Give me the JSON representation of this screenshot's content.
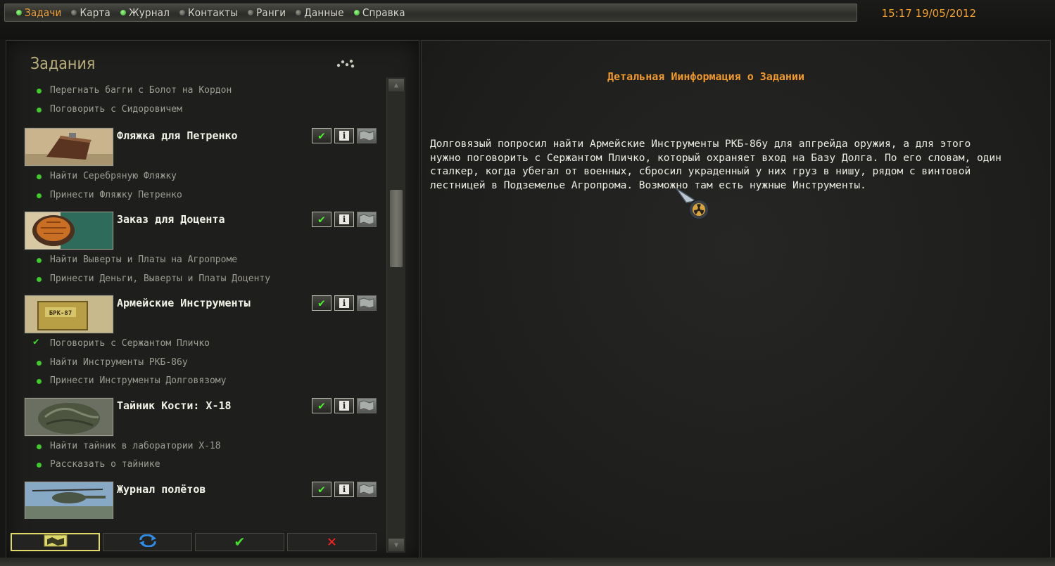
{
  "tabs": [
    {
      "label": "Задачи",
      "active": true,
      "dot_on": true
    },
    {
      "label": "Карта",
      "active": false,
      "dot_on": false
    },
    {
      "label": "Журнал",
      "active": false,
      "dot_on": true
    },
    {
      "label": "Контакты",
      "active": false,
      "dot_on": false
    },
    {
      "label": "Ранги",
      "active": false,
      "dot_on": false
    },
    {
      "label": "Данные",
      "active": false,
      "dot_on": false
    },
    {
      "label": "Справка",
      "active": false,
      "dot_on": true
    }
  ],
  "clock": "15:17 19/05/2012",
  "left": {
    "title": "Задания",
    "top_subtasks": [
      {
        "label": "Перегнать багги с Болот на Кордон"
      },
      {
        "label": "Поговорить с Сидоровичем"
      }
    ],
    "tasks": [
      {
        "name": "Фляжка для Петренко",
        "thumb": "flask-thumbnail",
        "subtasks": [
          {
            "label": "Найти Серебряную Фляжку",
            "done": false
          },
          {
            "label": "Принести Фляжку Петренко",
            "done": false
          }
        ]
      },
      {
        "name": "Заказ для Доцента",
        "thumb": "bread-thumbnail",
        "subtasks": [
          {
            "label": "Найти Выверты и Платы на Агропроме",
            "done": false
          },
          {
            "label": "Принести Деньги, Выверты и Платы Доценту",
            "done": false
          }
        ]
      },
      {
        "name": "Армейские Инструменты",
        "thumb": "toolbox-thumbnail",
        "thumb_text": "БРК-87",
        "subtasks": [
          {
            "label": "Поговорить с Сержантом Пличко",
            "done": true
          },
          {
            "label": "Найти Инструменты РКБ-86у",
            "done": false
          },
          {
            "label": "Принести Инструменты Долговязому",
            "done": false
          }
        ]
      },
      {
        "name": "Тайник Кости: X-18",
        "thumb": "stash-thumbnail",
        "subtasks": [
          {
            "label": "Найти тайник в лаборатории X-18",
            "done": false
          },
          {
            "label": "Рассказать о тайнике",
            "done": false
          }
        ]
      },
      {
        "name": "Журнал полётов",
        "thumb": "helicopter-thumbnail",
        "subtasks": []
      }
    ]
  },
  "bottom_buttons": [
    {
      "icon": "map-folder-icon",
      "selected": true
    },
    {
      "icon": "refresh-icon",
      "selected": false
    },
    {
      "icon": "check-icon",
      "selected": false
    },
    {
      "icon": "cross-icon",
      "selected": false
    }
  ],
  "detail": {
    "title": "Детальная Иинформация о Задании",
    "text": "Долговязый попросил найти Армейские Инструменты РКБ-86у для апгрейда оружия, а для этого нужно поговорить с Сержантом Пличко, который охраняет вход на Базу Долга. По его словам, один сталкер, когда убегал от военных, сбросил украденный у них груз в нишу, рядом с винтовой лестницей в Подземелье Агропрома. Возможно там есть нужные Инструменты."
  },
  "colors": {
    "accent": "#f09a2c",
    "active_dot": "#3fcb2a",
    "check": "#4cf22f",
    "cross": "#ff2222"
  }
}
